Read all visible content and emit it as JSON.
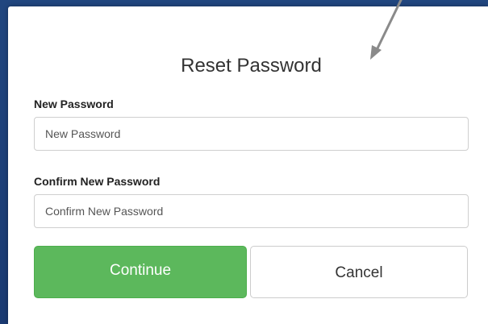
{
  "dialog": {
    "title": "Reset Password"
  },
  "form": {
    "new_password": {
      "label": "New Password",
      "placeholder": "New Password",
      "value": ""
    },
    "confirm_password": {
      "label": "Confirm New Password",
      "placeholder": "Confirm New Password",
      "value": ""
    }
  },
  "buttons": {
    "continue_label": "Continue",
    "cancel_label": "Cancel"
  },
  "colors": {
    "backdrop": "#1d3f78",
    "continue_bg": "#5cb85c",
    "annotation_arrow": "#8a8a8a"
  }
}
